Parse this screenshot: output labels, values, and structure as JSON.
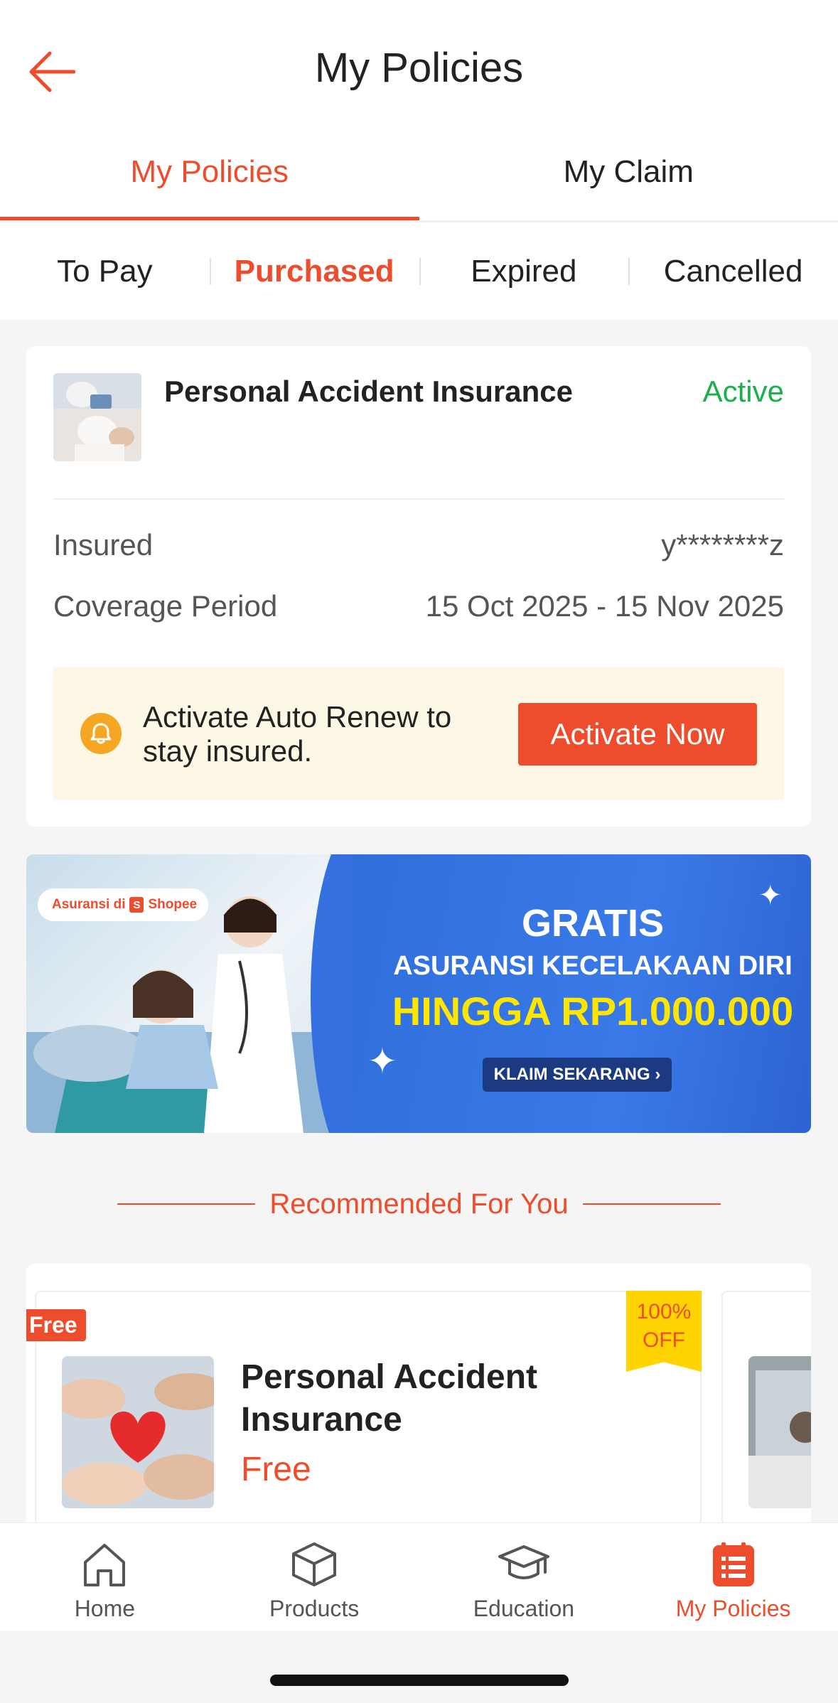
{
  "header": {
    "title": "My Policies"
  },
  "main_tabs": [
    {
      "label": "My Policies",
      "active": true
    },
    {
      "label": "My Claim",
      "active": false
    }
  ],
  "sub_tabs": [
    {
      "label": "To Pay",
      "active": false
    },
    {
      "label": "Purchased",
      "active": true
    },
    {
      "label": "Expired",
      "active": false
    },
    {
      "label": "Cancelled",
      "active": false
    }
  ],
  "policy": {
    "name": "Personal Accident Insurance",
    "status": "Active",
    "insured_label": "Insured",
    "insured_value": "y********z",
    "coverage_label": "Coverage Period",
    "coverage_value": "15 Oct 2025 - 15 Nov 2025",
    "renew_text": "Activate Auto Renew to stay insured.",
    "activate_label": "Activate Now"
  },
  "banner": {
    "chip_text": "Asuransi di",
    "chip_brand": "Shopee",
    "line1": "GRATIS",
    "line2": "ASURANSI KECELAKAAN DIRI",
    "line3": "HINGGA RP1.000.000",
    "cta": "KLAIM SEKARANG ›"
  },
  "recommended": {
    "title": "Recommended For You",
    "items": [
      {
        "tag": "Free",
        "name": "Personal Accident Insurance",
        "price": "Free",
        "discount_top": "100%",
        "discount_bottom": "OFF"
      }
    ]
  },
  "bottom_nav": [
    {
      "label": "Home",
      "icon": "home-icon",
      "active": false
    },
    {
      "label": "Products",
      "icon": "box-icon",
      "active": false
    },
    {
      "label": "Education",
      "icon": "graduation-cap-icon",
      "active": false
    },
    {
      "label": "My Policies",
      "icon": "policy-list-icon",
      "active": true
    }
  ],
  "colors": {
    "accent": "#ee4d2d",
    "status_active": "#1ab04c",
    "renew_bg": "#fdf8e6",
    "banner_blue": "#3470e0",
    "banner_highlight": "#ffe600"
  }
}
